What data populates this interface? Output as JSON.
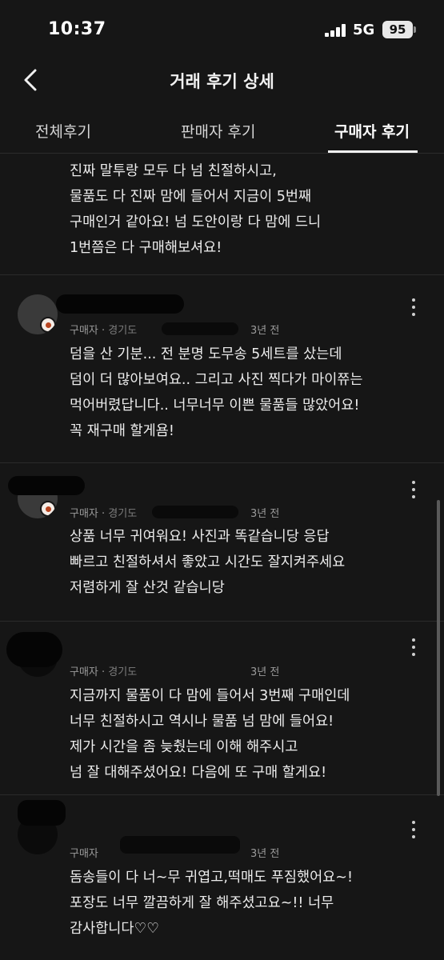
{
  "status_bar": {
    "time": "10:37",
    "network": "5G",
    "battery": "95"
  },
  "header": {
    "title": "거래 후기 상세"
  },
  "tabs": [
    {
      "label": "전체후기",
      "active": false
    },
    {
      "label": "판매자 후기",
      "active": false
    },
    {
      "label": "구매자 후기",
      "active": true
    }
  ],
  "reviews": [
    {
      "text": "진짜 말투랑 모두 다 넘 친절하시고,\n물품도 다 진짜 맘에 들어서 지금이 5번째\n구매인거 같아요! 넘 도안이랑 다 맘에 드니\n1번쯤은 다 구매해보셔요!"
    },
    {
      "role": "구매자",
      "location": "경기도",
      "ago": "3년 전",
      "text": "덤을 산 기분... 전 분명 도무송 5세트를 샀는데\n덤이 더 많아보여요.. 그리고 사진 찍다가 마이쮸는\n먹어버렸답니다.. 너무너무 이쁜 물품들 많았어요!\n꼭 재구매 할게욤!"
    },
    {
      "role": "구매자",
      "location": "경기도",
      "ago": "3년 전",
      "text": "상품 너무 귀여워요! 사진과 똑같습니당 응답\n빠르고 친절하셔서 좋았고 시간도 잘지켜주세요\n저렴하게 잘 산것 같습니당"
    },
    {
      "role": "구매자",
      "location": "경기도",
      "ago": "3년 전",
      "text": "지금까지 물품이 다 맘에 들어서 3번째 구매인데\n너무 친절하시고 역시나 물품 넘 맘에 들어요!\n제가 시간을 좀 늦췄는데 이해 해주시고\n넘 잘 대해주셨어요! 다음에 또 구매 할게요!"
    },
    {
      "role": "구매자",
      "location": "",
      "ago": "3년 전",
      "text": "돔송들이 다 너~무 귀엽고,떡매도 푸짐했어요~!\n포장도 너무 깔끔하게 잘 해주셨고요~!! 너무\n감사합니다♡♡"
    }
  ],
  "colors": {
    "background": "#161616",
    "text": "#ececec",
    "muted": "#9b9b9b",
    "accent_badge": "#b7441f"
  },
  "icons": {
    "back": "chevron-left-icon",
    "more": "more-vertical-icon"
  }
}
